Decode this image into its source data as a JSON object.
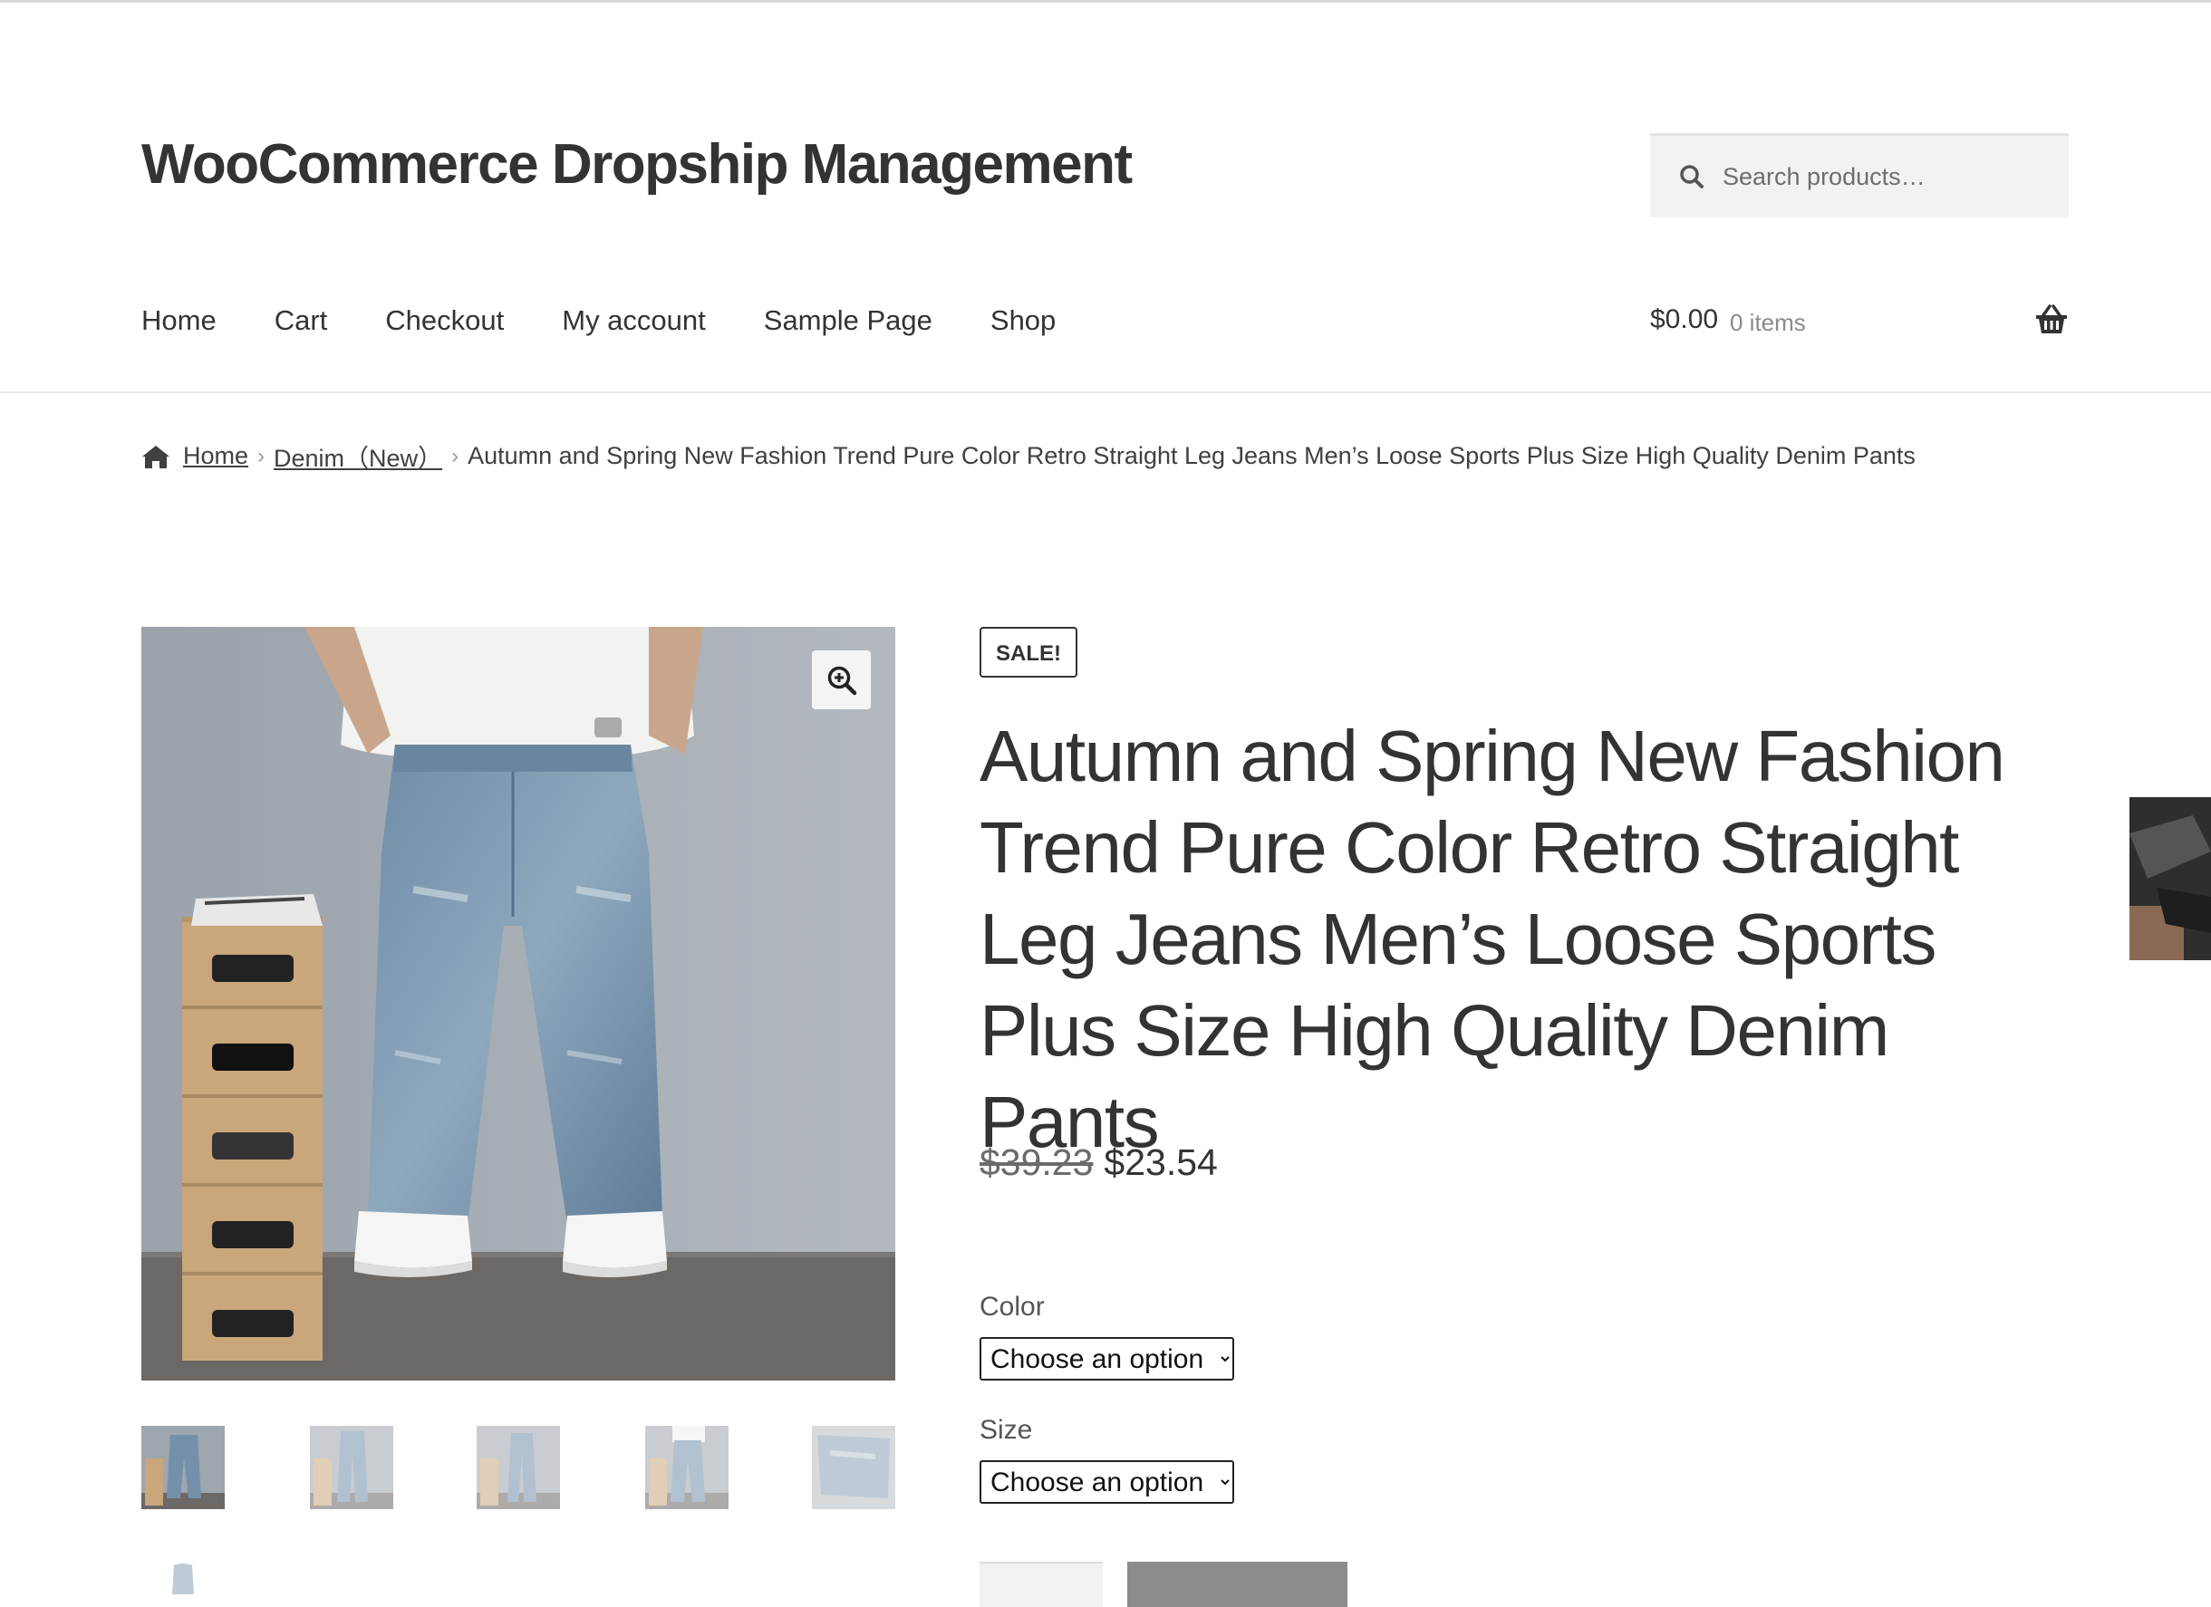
{
  "site": {
    "title": "WooCommerce Dropship Management",
    "search_placeholder": "Search products…"
  },
  "nav": {
    "items": [
      "Home",
      "Cart",
      "Checkout",
      "My account",
      "Sample Page",
      "Shop"
    ]
  },
  "cart": {
    "amount": "$0.00",
    "items": "0 items",
    "icon": "basket-icon"
  },
  "breadcrumb": {
    "home": "Home",
    "category": "Denim（New）",
    "current": "Autumn and Spring New Fashion Trend Pure Color Retro Straight Leg Jeans Men’s Loose Sports Plus Size High Quality Denim Pants"
  },
  "product": {
    "badge": "SALE!",
    "title": "Autumn and Spring New Fashion Trend Pure Color Retro Straight Leg Jeans Men’s Loose Sports Plus Size High Quality Denim Pants",
    "price_old": "$39.23",
    "price_new": "$23.54",
    "color_label": "Color",
    "size_label": "Size",
    "color_selected": "Choose an option",
    "size_selected": "Choose an option"
  },
  "colors": {
    "accent_gray": "#8c8c8c",
    "text": "#333333"
  }
}
